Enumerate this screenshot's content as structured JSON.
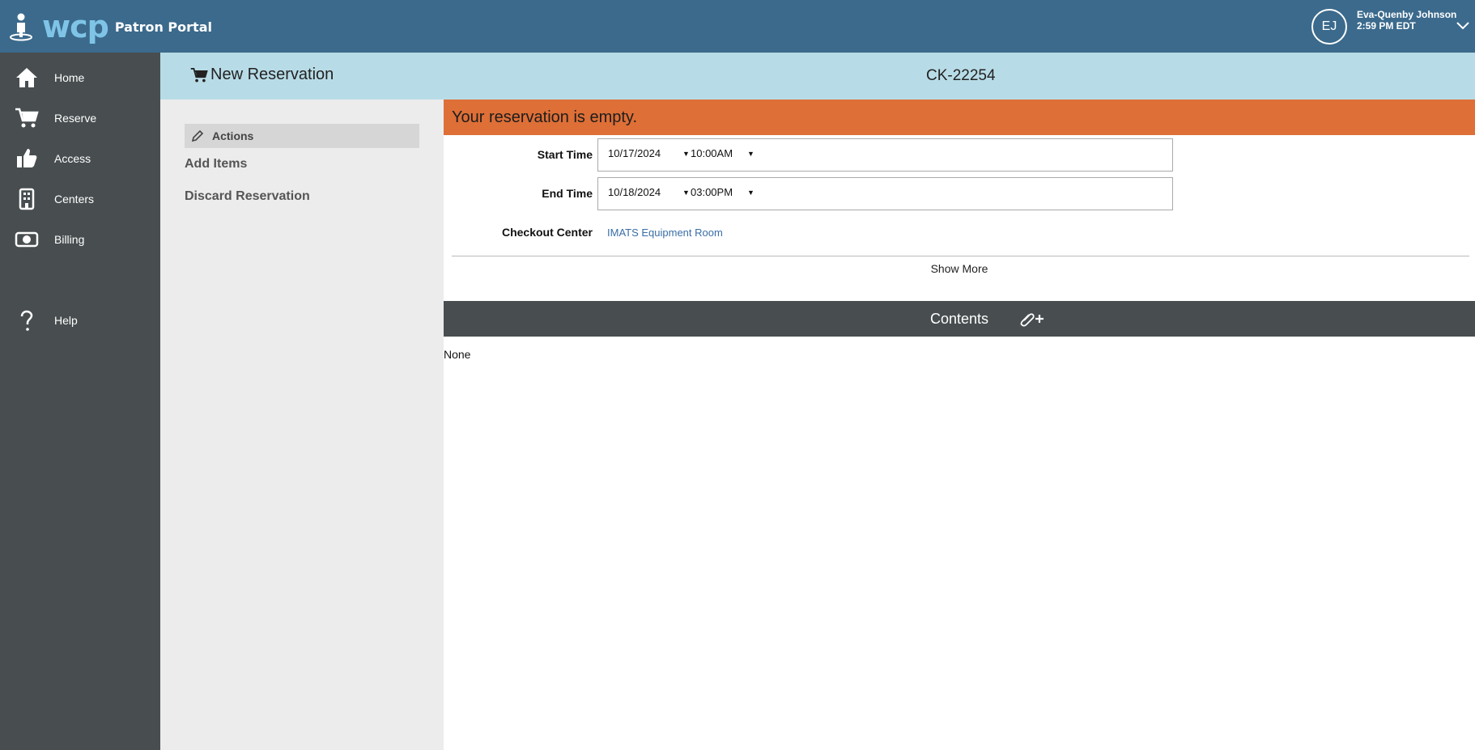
{
  "topbar": {
    "logo_text": "wcp",
    "portal_label": "Patron Portal",
    "user_initials": "EJ",
    "user_name": "Eva-Quenby Johnson",
    "user_time": "2:59 PM EDT"
  },
  "sidebar": {
    "items": [
      {
        "label": "Home",
        "icon": "home-icon"
      },
      {
        "label": "Reserve",
        "icon": "cart-icon"
      },
      {
        "label": "Access",
        "icon": "thumbs-up-icon"
      },
      {
        "label": "Centers",
        "icon": "building-icon"
      },
      {
        "label": "Billing",
        "icon": "money-icon"
      },
      {
        "label": "Help",
        "icon": "question-icon"
      }
    ]
  },
  "header": {
    "title": "New Reservation",
    "record_id": "CK-22254"
  },
  "actions": {
    "header": "Actions",
    "add_items": "Add Items",
    "discard": "Discard Reservation"
  },
  "main": {
    "alert": "Your reservation is empty.",
    "start_label": "Start Time",
    "start_date": "10/17/2024",
    "start_time": "10:00AM",
    "end_label": "End Time",
    "end_date": "10/18/2024",
    "end_time": "03:00PM",
    "center_label": "Checkout Center",
    "center_value": "IMATS Equipment Room",
    "show_more": "Show More",
    "contents_title": "Contents",
    "contents_empty": "None"
  },
  "colors": {
    "topbar": "#3b6a8c",
    "sidebar": "#484e50",
    "header": "#b8dce7",
    "alert": "#de6f37",
    "link": "#3a6ea5"
  }
}
